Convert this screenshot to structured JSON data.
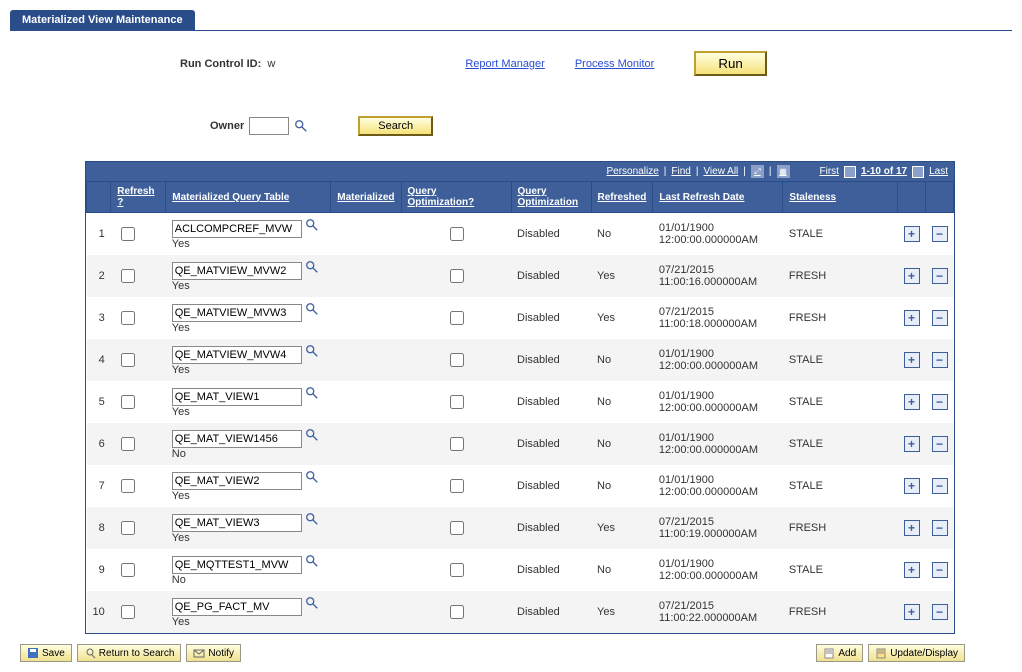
{
  "tab": {
    "title": "Materialized View Maintenance"
  },
  "top": {
    "run_control_label": "Run Control ID:",
    "run_control_value": "w",
    "report_manager": "Report Manager",
    "process_monitor": "Process Monitor",
    "run_btn": "Run"
  },
  "owner": {
    "label": "Owner",
    "value": "",
    "search_btn": "Search"
  },
  "grid": {
    "toolbar": {
      "personalize": "Personalize",
      "find": "Find",
      "view_all": "View All",
      "first": "First",
      "range": "1-10 of 17",
      "last": "Last"
    },
    "headers": {
      "refresh": "Refresh ?",
      "mqt": "Materialized Query Table",
      "materialized": "Materialized",
      "qopt": "Query Optimization?",
      "qoptval": "Query Optimization",
      "refreshed": "Refreshed",
      "lastdate": "Last Refresh Date",
      "staleness": "Staleness"
    },
    "rows": [
      {
        "n": "1",
        "name": "ACLCOMPCREF_MVW",
        "mat": "Yes",
        "qo": "Disabled",
        "ref": "No",
        "date1": "01/01/1900",
        "date2": "12:00:00.000000AM",
        "stale": "STALE"
      },
      {
        "n": "2",
        "name": "QE_MATVIEW_MVW2",
        "mat": "Yes",
        "qo": "Disabled",
        "ref": "Yes",
        "date1": "07/21/2015",
        "date2": "11:00:16.000000AM",
        "stale": "FRESH"
      },
      {
        "n": "3",
        "name": "QE_MATVIEW_MVW3",
        "mat": "Yes",
        "qo": "Disabled",
        "ref": "Yes",
        "date1": "07/21/2015",
        "date2": "11:00:18.000000AM",
        "stale": "FRESH"
      },
      {
        "n": "4",
        "name": "QE_MATVIEW_MVW4",
        "mat": "Yes",
        "qo": "Disabled",
        "ref": "No",
        "date1": "01/01/1900",
        "date2": "12:00:00.000000AM",
        "stale": "STALE"
      },
      {
        "n": "5",
        "name": "QE_MAT_VIEW1",
        "mat": "Yes",
        "qo": "Disabled",
        "ref": "No",
        "date1": "01/01/1900",
        "date2": "12:00:00.000000AM",
        "stale": "STALE"
      },
      {
        "n": "6",
        "name": "QE_MAT_VIEW1456",
        "mat": "No",
        "qo": "Disabled",
        "ref": "No",
        "date1": "01/01/1900",
        "date2": "12:00:00.000000AM",
        "stale": "STALE"
      },
      {
        "n": "7",
        "name": "QE_MAT_VIEW2",
        "mat": "Yes",
        "qo": "Disabled",
        "ref": "No",
        "date1": "01/01/1900",
        "date2": "12:00:00.000000AM",
        "stale": "STALE"
      },
      {
        "n": "8",
        "name": "QE_MAT_VIEW3",
        "mat": "Yes",
        "qo": "Disabled",
        "ref": "Yes",
        "date1": "07/21/2015",
        "date2": "11:00:19.000000AM",
        "stale": "FRESH"
      },
      {
        "n": "9",
        "name": "QE_MQTTEST1_MVW",
        "mat": "No",
        "qo": "Disabled",
        "ref": "No",
        "date1": "01/01/1900",
        "date2": "12:00:00.000000AM",
        "stale": "STALE"
      },
      {
        "n": "10",
        "name": "QE_PG_FACT_MV",
        "mat": "Yes",
        "qo": "Disabled",
        "ref": "Yes",
        "date1": "07/21/2015",
        "date2": "11:00:22.000000AM",
        "stale": "FRESH"
      }
    ]
  },
  "footer": {
    "save": "Save",
    "return": "Return to Search",
    "notify": "Notify",
    "add": "Add",
    "update": "Update/Display"
  }
}
